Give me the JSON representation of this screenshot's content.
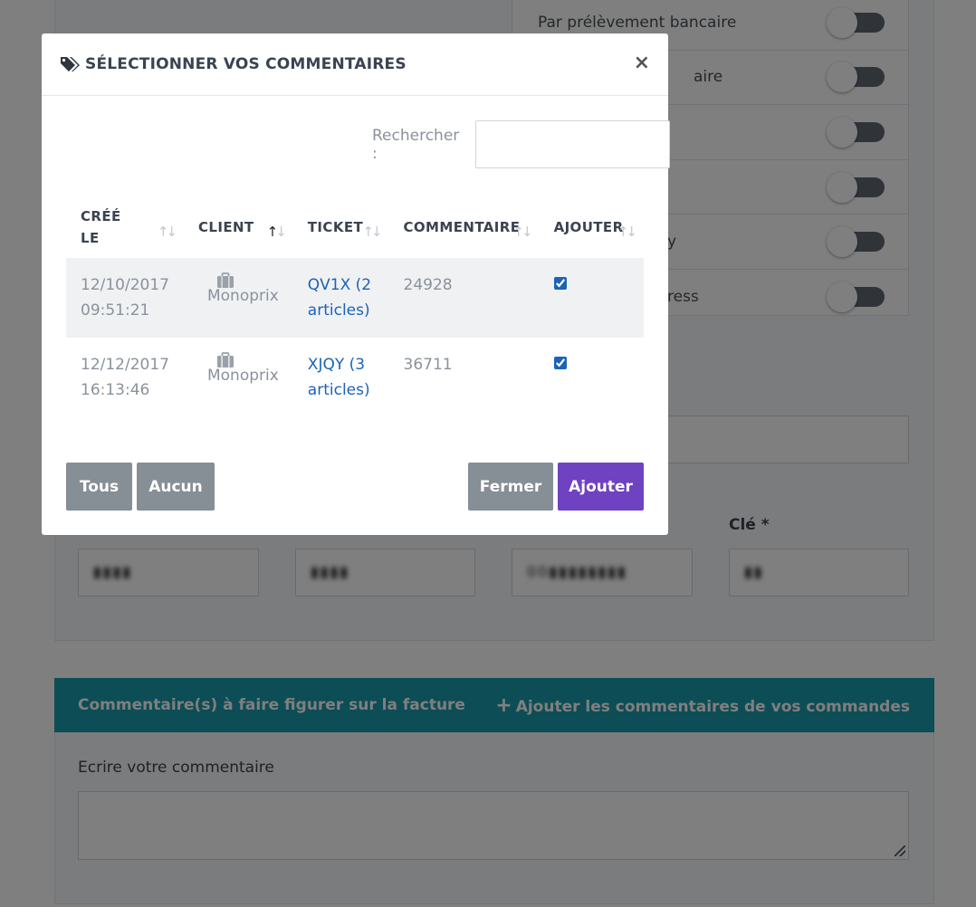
{
  "background": {
    "toggles": [
      {
        "label": "Par prélèvement bancaire"
      },
      {
        "label": "aire"
      },
      {
        "label": ""
      },
      {
        "label": ""
      },
      {
        "label": "y"
      },
      {
        "label": "ress"
      }
    ],
    "key_label": "Clé *",
    "inputs": [
      {
        "value": "▮▮▮▮"
      },
      {
        "value": "▮▮▮▮"
      },
      {
        "value": "00▮▮▮▮▮▮▮▮"
      },
      {
        "value": "▮▮"
      }
    ],
    "comments_card": {
      "title": "Commentaire(s) à faire figurer sur la facture",
      "add_link": "Ajouter les commentaires de vos commandes",
      "comment_label": "Ecrire votre commentaire"
    }
  },
  "modal": {
    "title": "SÉLECTIONNER VOS COMMENTAIRES",
    "close": "×",
    "search_label": "Rechercher :",
    "search_placeholder": "",
    "columns": [
      "CRÉÉ LE",
      "CLIENT",
      "TICKET",
      "COMMENTAIRE",
      "AJOUTER"
    ],
    "sort": {
      "active_column": "CLIENT",
      "direction": "asc"
    },
    "rows": [
      {
        "date": "12/10/2017",
        "time": "09:51:21",
        "client": "Monoprix",
        "ticket_line1": "QV1X (2",
        "ticket_line2": "articles)",
        "comment": "24928",
        "checked": true
      },
      {
        "date": "12/12/2017",
        "time": "16:13:46",
        "client": "Monoprix",
        "ticket_line1": "XJQY (3",
        "ticket_line2": "articles)",
        "comment": "36711",
        "checked": true
      }
    ],
    "buttons": {
      "all": "Tous",
      "none": "Aucun",
      "close": "Fermer",
      "add": "Ajouter"
    }
  },
  "colors": {
    "primary": "#6f42c1",
    "secondary": "#868e96",
    "teal": "#1b9aaa",
    "link": "#1a63b8"
  }
}
